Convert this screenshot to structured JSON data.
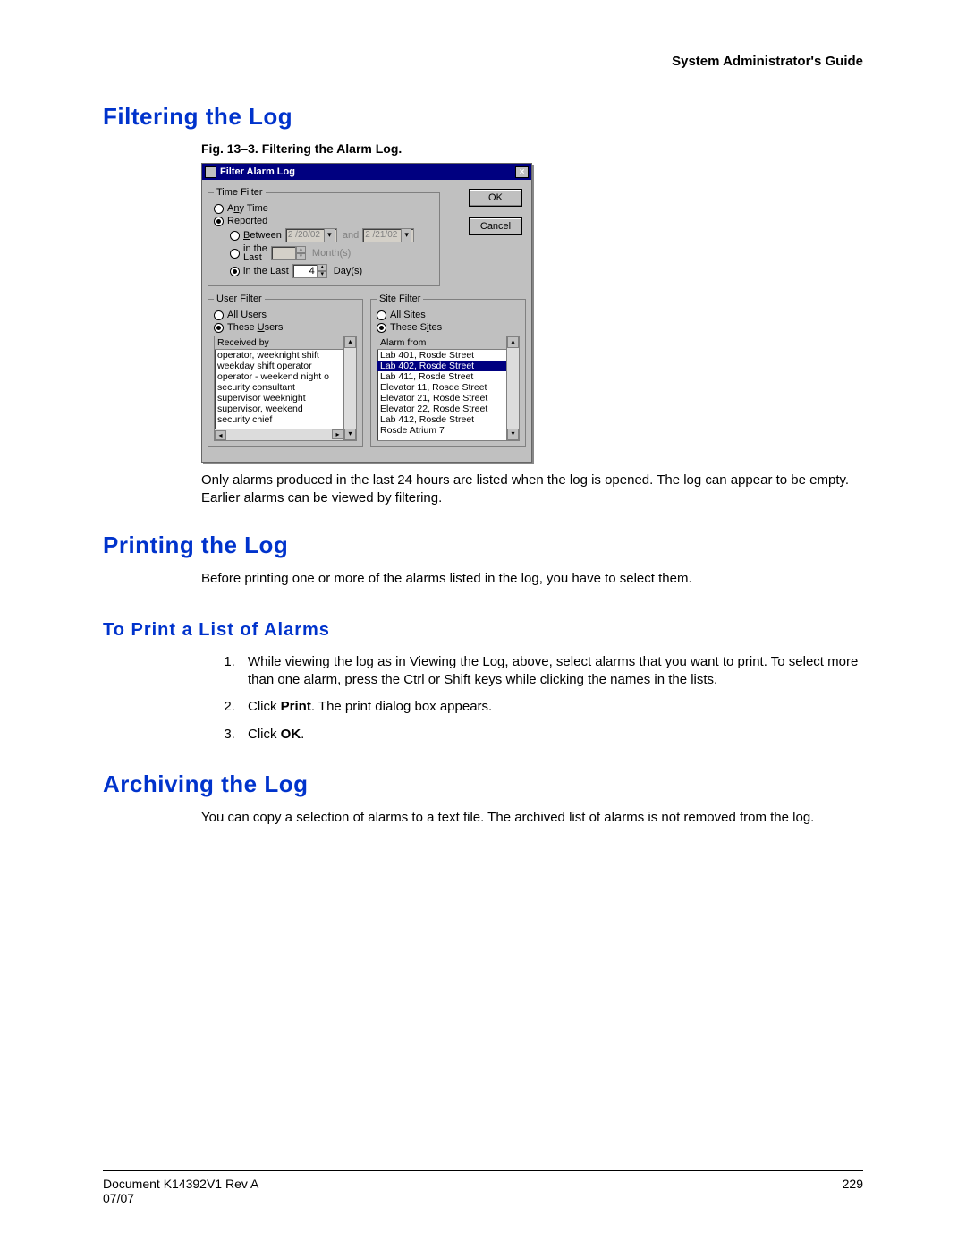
{
  "running_head": "System Administrator's Guide",
  "sections": {
    "filtering": {
      "title": "Filtering the Log",
      "figure_caption": "Fig. 13–3.   Filtering the Alarm Log.",
      "body": "Only alarms produced in the last 24 hours are listed when the log is opened. The log can appear to be empty. Earlier alarms can be viewed by filtering."
    },
    "printing": {
      "title": "Printing the Log",
      "intro": "Before printing one or more of the alarms listed in the log, you have to select them.",
      "sub_title": "To Print a List of Alarms",
      "steps": [
        "While viewing the log as in Viewing the Log, above, select alarms that you want to print. To select more than one alarm, press the Ctrl or Shift keys while clicking the names in the lists.",
        "Click Print. The print dialog box appears.",
        "Click OK."
      ]
    },
    "archiving": {
      "title": "Archiving the Log",
      "body": "You can copy a selection of alarms to a text file. The archived list of alarms is not removed from the log."
    }
  },
  "dialog": {
    "title": "Filter Alarm Log",
    "ok": "OK",
    "cancel": "Cancel",
    "time_filter": {
      "legend": "Time Filter",
      "any_time": "Any Time",
      "reported": "Reported",
      "between": "Between",
      "between_date1": "2 /20/02",
      "and": "and",
      "between_date2": "2 /21/02",
      "in_last_months_label1": "in the",
      "in_last_months_label2": "Last",
      "months_unit": "Month(s)",
      "in_last_days": "in the Last",
      "days_value": "4",
      "days_unit": "Day(s)"
    },
    "user_filter": {
      "legend": "User Filter",
      "all": "All Users",
      "these": "These Users",
      "header": "Received by",
      "items": [
        "operator, weeknight shift",
        "weekday shift operator",
        "operator - weekend night o",
        "security consultant",
        "supervisor weeknight",
        "supervisor, weekend",
        "security chief"
      ]
    },
    "site_filter": {
      "legend": "Site Filter",
      "all": "All Sites",
      "these": "These Sites",
      "header": "Alarm from",
      "items": [
        "Lab 401, Rosde Street",
        "Lab 402, Rosde Street",
        "Lab 411, Rosde Street",
        "Elevator 11, Rosde Street",
        "Elevator 21, Rosde Street",
        "Elevator 22, Rosde Street",
        "Lab 412, Rosde Street",
        "Rosde Atrium 7"
      ],
      "selected_index": 1
    }
  },
  "footer": {
    "doc": "Document K14392V1 Rev A",
    "date": "07/07",
    "page": "229"
  }
}
